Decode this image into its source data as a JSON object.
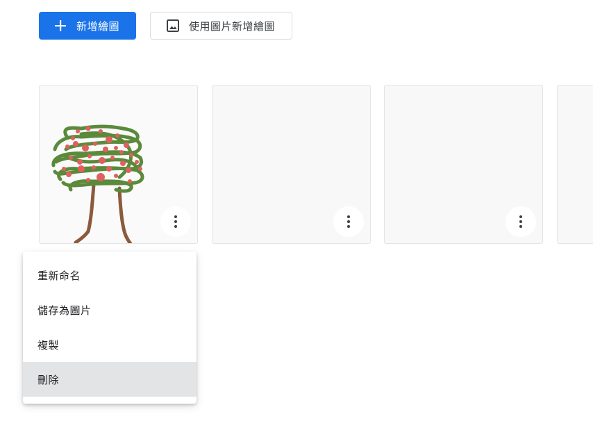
{
  "toolbar": {
    "new_drawing_label": "新增繪圖",
    "new_from_image_label": "使用圖片新增繪圖",
    "new_drawing_icon": "plus-icon",
    "new_from_image_icon": "image-icon"
  },
  "cards": [
    {
      "has_drawing": true,
      "more_icon": "more-vert-icon"
    },
    {
      "has_drawing": false,
      "more_icon": "more-vert-icon"
    },
    {
      "has_drawing": false,
      "more_icon": "more-vert-icon"
    },
    {
      "has_drawing": false,
      "more_icon": "more-vert-icon"
    }
  ],
  "context_menu": {
    "items": [
      {
        "label": "重新命名"
      },
      {
        "label": "儲存為圖片"
      },
      {
        "label": "複製"
      },
      {
        "label": "刪除",
        "hovered": true
      }
    ]
  },
  "colors": {
    "primary": "#1a73e8",
    "card_bg": "#f8f8f8",
    "menu_hover": "#e3e4e6",
    "tree_leaves": "#5a8a3a",
    "tree_trunk": "#8b5a3c",
    "tree_fruit": "#e06060"
  }
}
